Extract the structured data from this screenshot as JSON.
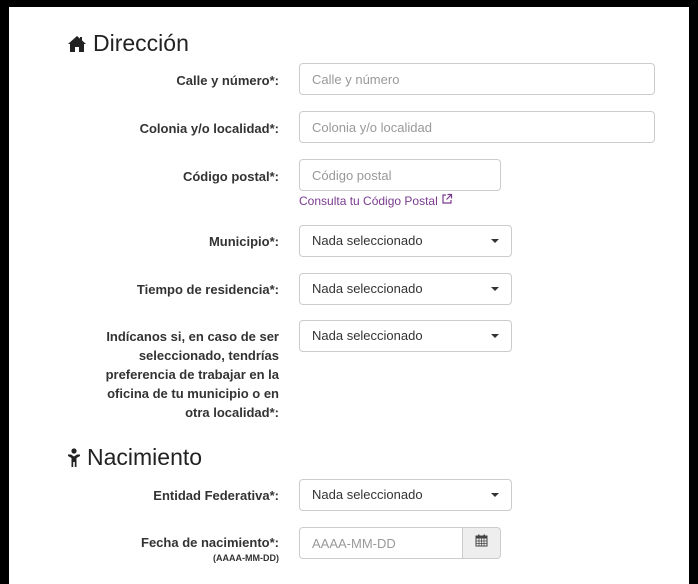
{
  "direccion": {
    "title": "Dirección",
    "calle": {
      "label": "Calle y número*:",
      "placeholder": "Calle y número"
    },
    "colonia": {
      "label": "Colonia y/o localidad*:",
      "placeholder": "Colonia y/o localidad"
    },
    "cp": {
      "label": "Código postal*:",
      "placeholder": "Código postal",
      "link": "Consulta tu Código Postal"
    },
    "municipio": {
      "label": "Municipio*:",
      "value": "Nada seleccionado"
    },
    "residencia": {
      "label": "Tiempo de residencia*:",
      "value": "Nada seleccionado"
    },
    "preferencia": {
      "label": "Indícanos si, en caso de ser seleccionado, tendrías preferencia de trabajar en la oficina de tu municipio o en otra localidad*:",
      "value": "Nada seleccionado"
    }
  },
  "nacimiento": {
    "title": "Nacimiento",
    "entidad": {
      "label": "Entidad Federativa*:",
      "value": "Nada seleccionado"
    },
    "fecha": {
      "label": "Fecha de nacimiento*:",
      "sublabel": "(AAAA-MM-DD)",
      "placeholder": "AAAA-MM-DD"
    }
  },
  "colors": {
    "link": "#7a3b8f",
    "border": "#cccccc",
    "addon_bg": "#eeeeee"
  },
  "icons": {
    "direccion": "home-icon",
    "nacimiento": "person-icon",
    "link": "external-link-icon",
    "fecha": "calendar-icon"
  }
}
